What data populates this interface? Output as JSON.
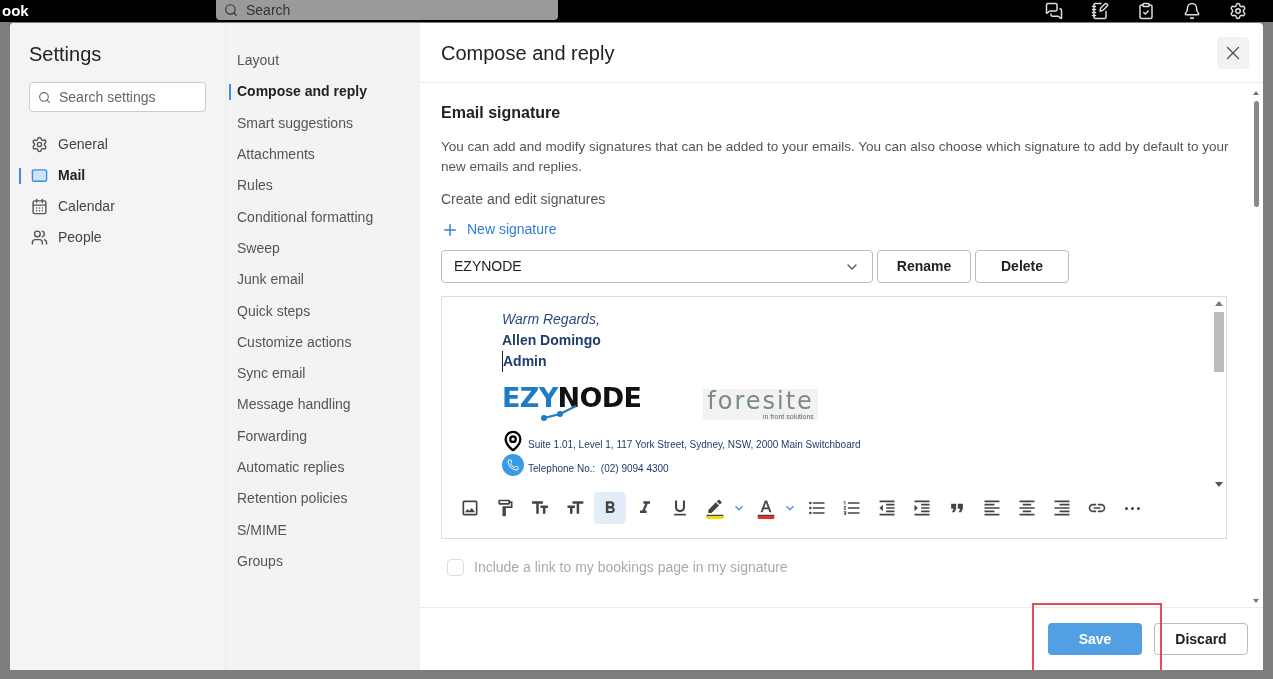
{
  "app_bar": {
    "title": "ook",
    "search": {
      "placeholder": "Search"
    }
  },
  "settings": {
    "title": "Settings",
    "search": {
      "placeholder": "Search settings"
    },
    "categories": [
      {
        "label": "General",
        "kind": "settings",
        "selected": false
      },
      {
        "label": "Mail",
        "kind": "mail",
        "selected": true
      },
      {
        "label": "Calendar",
        "kind": "calendar",
        "selected": false
      },
      {
        "label": "People",
        "kind": "people",
        "selected": false
      }
    ]
  },
  "subnav": [
    {
      "label": "Layout",
      "selected": false
    },
    {
      "label": "Compose and reply",
      "selected": true
    },
    {
      "label": "Smart suggestions",
      "selected": false
    },
    {
      "label": "Attachments",
      "selected": false
    },
    {
      "label": "Rules",
      "selected": false
    },
    {
      "label": "Conditional formatting",
      "selected": false
    },
    {
      "label": "Sweep",
      "selected": false
    },
    {
      "label": "Junk email",
      "selected": false
    },
    {
      "label": "Quick steps",
      "selected": false
    },
    {
      "label": "Customize actions",
      "selected": false
    },
    {
      "label": "Sync email",
      "selected": false
    },
    {
      "label": "Message handling",
      "selected": false
    },
    {
      "label": "Forwarding",
      "selected": false
    },
    {
      "label": "Automatic replies",
      "selected": false
    },
    {
      "label": "Retention policies",
      "selected": false
    },
    {
      "label": "S/MIME",
      "selected": false
    },
    {
      "label": "Groups",
      "selected": false
    }
  ],
  "panel": {
    "title": "Compose and reply",
    "section": "Email signature",
    "description": "You can add and modify signatures that can be added to your emails. You can also choose which signature to add by default to your new emails and replies.",
    "create_label": "Create and edit signatures",
    "new_signature": "New signature",
    "signature_select": "EZYNODE",
    "rename": "Rename",
    "delete": "Delete",
    "signature": {
      "closing": "Warm Regards,",
      "name": "Allen Domingo",
      "role": "Admin",
      "logo_1": "EZYNODE",
      "logo_2": "foresite",
      "logo_2_tagline": "in front solutions",
      "address": "Suite 1.01, Level 1, 117 York Street, Sydney, NSW, 2000 Main Switchboard",
      "phone": "Telephone No.:  (02) 9094 4300"
    },
    "toolbar": [
      {
        "kind": "image",
        "selected": false
      },
      {
        "kind": "paint",
        "selected": false
      },
      {
        "kind": "size",
        "selected": false
      },
      {
        "kind": "grow",
        "selected": false
      },
      {
        "kind": "bold",
        "selected": true
      },
      {
        "kind": "italic",
        "selected": false
      },
      {
        "kind": "underline",
        "selected": false
      },
      {
        "kind": "highlight",
        "selected": false,
        "color": "#f0e000"
      },
      {
        "kind": "fontcolor",
        "selected": false,
        "color": "#e03030"
      },
      {
        "kind": "bullets",
        "selected": false
      },
      {
        "kind": "numbers",
        "selected": false
      },
      {
        "kind": "outdent",
        "selected": false
      },
      {
        "kind": "indent",
        "selected": false
      },
      {
        "kind": "quote",
        "selected": false
      },
      {
        "kind": "left",
        "selected": false
      },
      {
        "kind": "center",
        "selected": false
      },
      {
        "kind": "right",
        "selected": false
      },
      {
        "kind": "link",
        "selected": false
      },
      {
        "kind": "more",
        "selected": false
      }
    ],
    "bookings": {
      "label": "Include a link to my bookings page in my signature",
      "checked": false,
      "disabled": true
    }
  },
  "footer": {
    "save": "Save",
    "discard": "Discard",
    "save_highlighted": true
  }
}
